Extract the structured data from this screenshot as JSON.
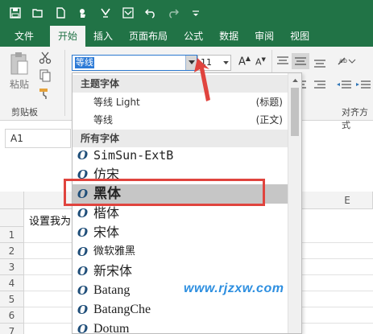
{
  "quick_access": {
    "icons": [
      "save-icon",
      "open-icon",
      "new-icon",
      "touch-mode-icon",
      "format-painter-icon",
      "spelling-icon",
      "undo-icon",
      "redo-icon",
      "customize-icon"
    ]
  },
  "tabs": [
    {
      "label": "文件"
    },
    {
      "label": "开始",
      "active": true
    },
    {
      "label": "插入"
    },
    {
      "label": "页面布局"
    },
    {
      "label": "公式"
    },
    {
      "label": "数据"
    },
    {
      "label": "审阅"
    },
    {
      "label": "视图"
    }
  ],
  "ribbon": {
    "paste_label": "粘贴",
    "clipboard_label": "剪贴板",
    "font_name_value": "等线",
    "font_size_value": "11",
    "alignment_label": "对齐方式"
  },
  "name_box": "A1",
  "grid": {
    "column_e": "E",
    "rows": [
      "1",
      "2",
      "3",
      "4",
      "5",
      "6",
      "7"
    ],
    "cell_a1_text": "设置我为"
  },
  "font_dropdown": {
    "theme_header": "主题字体",
    "theme_fonts": [
      {
        "name": "等线 Light",
        "tag": "(标题)"
      },
      {
        "name": "等线",
        "tag": "(正文)"
      }
    ],
    "all_header": "所有字体",
    "fonts": [
      {
        "name": "SimSun-ExtB"
      },
      {
        "name": "仿宋"
      },
      {
        "name": "黑体",
        "selected": true
      },
      {
        "name": "楷体"
      },
      {
        "name": "宋体"
      },
      {
        "name": "微软雅黑"
      },
      {
        "name": "新宋体"
      },
      {
        "name": "Batang"
      },
      {
        "name": "BatangChe"
      },
      {
        "name": "Dotum"
      }
    ]
  },
  "watermark": "www.rjzxw.com",
  "colors": {
    "excel_green": "#217346",
    "highlight_red": "#e0443e",
    "selection_blue": "#2c7ad6"
  }
}
